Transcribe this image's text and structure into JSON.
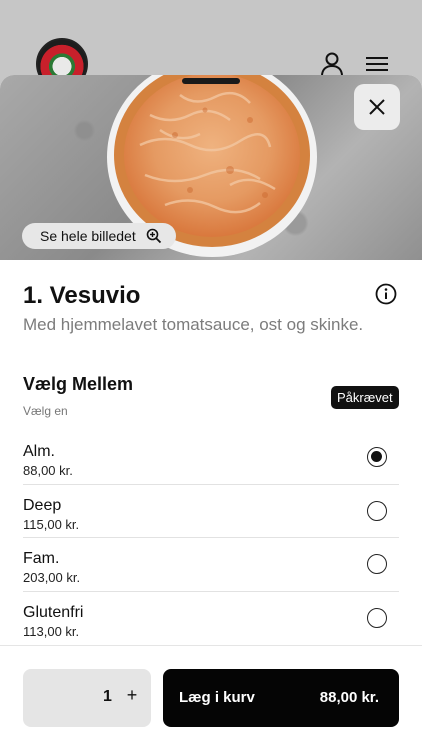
{
  "hero": {
    "view_image_label": "Se hele billedet",
    "close_icon": "close-icon",
    "zoom_icon": "zoom-in-icon"
  },
  "product": {
    "title": "1. Vesuvio",
    "description": "Med hjemmelavet tomatsauce, ost og skinke."
  },
  "option_group": {
    "title": "Vælg Mellem",
    "subtitle": "Vælg en",
    "badge": "Påkrævet",
    "options": [
      {
        "name": "Alm.",
        "price": "88,00 kr.",
        "selected": true
      },
      {
        "name": "Deep",
        "price": "115,00 kr.",
        "selected": false
      },
      {
        "name": "Fam.",
        "price": "203,00 kr.",
        "selected": false
      },
      {
        "name": "Glutenfri",
        "price": "113,00 kr.",
        "selected": false
      }
    ]
  },
  "cart": {
    "quantity": "1",
    "plus_label": "+",
    "add_label": "Læg i kurv",
    "total": "88,00 kr."
  }
}
